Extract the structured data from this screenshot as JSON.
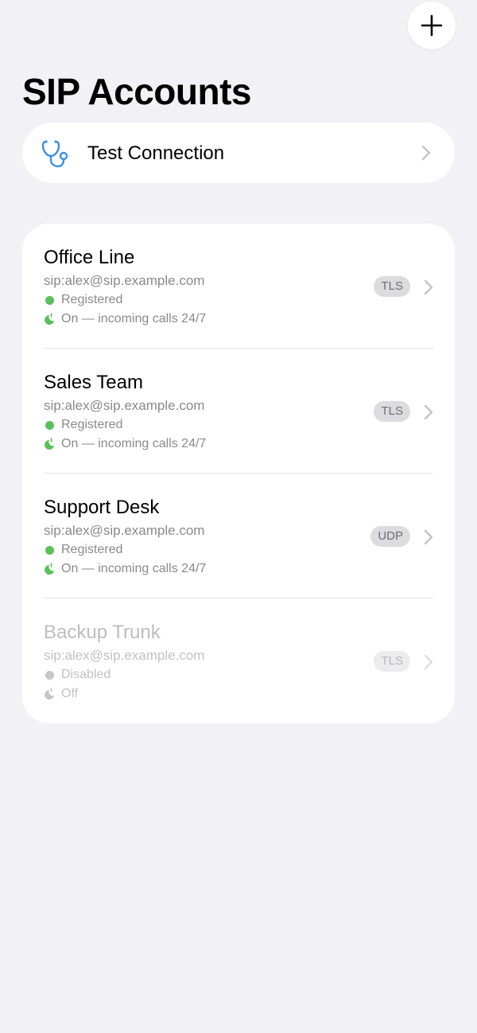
{
  "header": {
    "add_button_icon": "plus-icon",
    "title": "SIP Accounts"
  },
  "test_connection": {
    "icon": "stethoscope-icon",
    "label": "Test Connection",
    "icon_color": "#3a8ee6"
  },
  "colors": {
    "background": "#f1f1f6",
    "registered": "#5ac05a",
    "disabled": "#c6c6ca"
  },
  "accounts": [
    {
      "name": "Office Line",
      "uri": "sip:alex@sip.example.com",
      "status": "Registered",
      "mode": "On — incoming calls 24/7",
      "transport": "TLS",
      "enabled": true
    },
    {
      "name": "Sales Team",
      "uri": "sip:alex@sip.example.com",
      "status": "Registered",
      "mode": "On — incoming calls 24/7",
      "transport": "TLS",
      "enabled": true
    },
    {
      "name": "Support Desk",
      "uri": "sip:alex@sip.example.com",
      "status": "Registered",
      "mode": "On — incoming calls 24/7",
      "transport": "UDP",
      "enabled": true
    },
    {
      "name": "Backup Trunk",
      "uri": "sip:alex@sip.example.com",
      "status": "Disabled",
      "mode": "Off",
      "transport": "TLS",
      "enabled": false
    }
  ]
}
